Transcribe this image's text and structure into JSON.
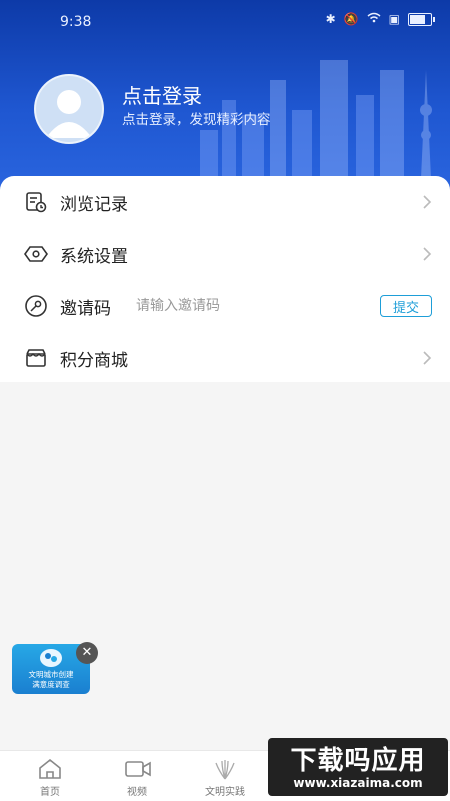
{
  "status_bar": {
    "time": "9:38",
    "battery_level": 0.7
  },
  "profile": {
    "title": "点击登录",
    "subtitle": "点击登录，发现精彩内容"
  },
  "menu": {
    "history": {
      "label": "浏览记录",
      "icon": "history-icon"
    },
    "settings": {
      "label": "系统设置",
      "icon": "settings-icon"
    },
    "invite": {
      "label": "邀请码",
      "placeholder": "请输入邀请码",
      "submit_label": "提交",
      "icon": "key-icon"
    },
    "shop": {
      "label": "积分商城",
      "icon": "shop-icon"
    }
  },
  "floating_banner": {
    "line1": "文明城市创建",
    "line2": "满意度调查"
  },
  "tabbar": {
    "tabs": [
      {
        "label": "首页",
        "icon": "home-icon"
      },
      {
        "label": "视频",
        "icon": "video-icon"
      },
      {
        "label": "文明实践",
        "icon": "peacock-icon"
      }
    ]
  },
  "watermark": {
    "cn": "下载吗应用",
    "en": "www.xiazaima.com"
  },
  "colors": {
    "header_blue": "#1f57d1",
    "accent": "#1e9ed8"
  }
}
